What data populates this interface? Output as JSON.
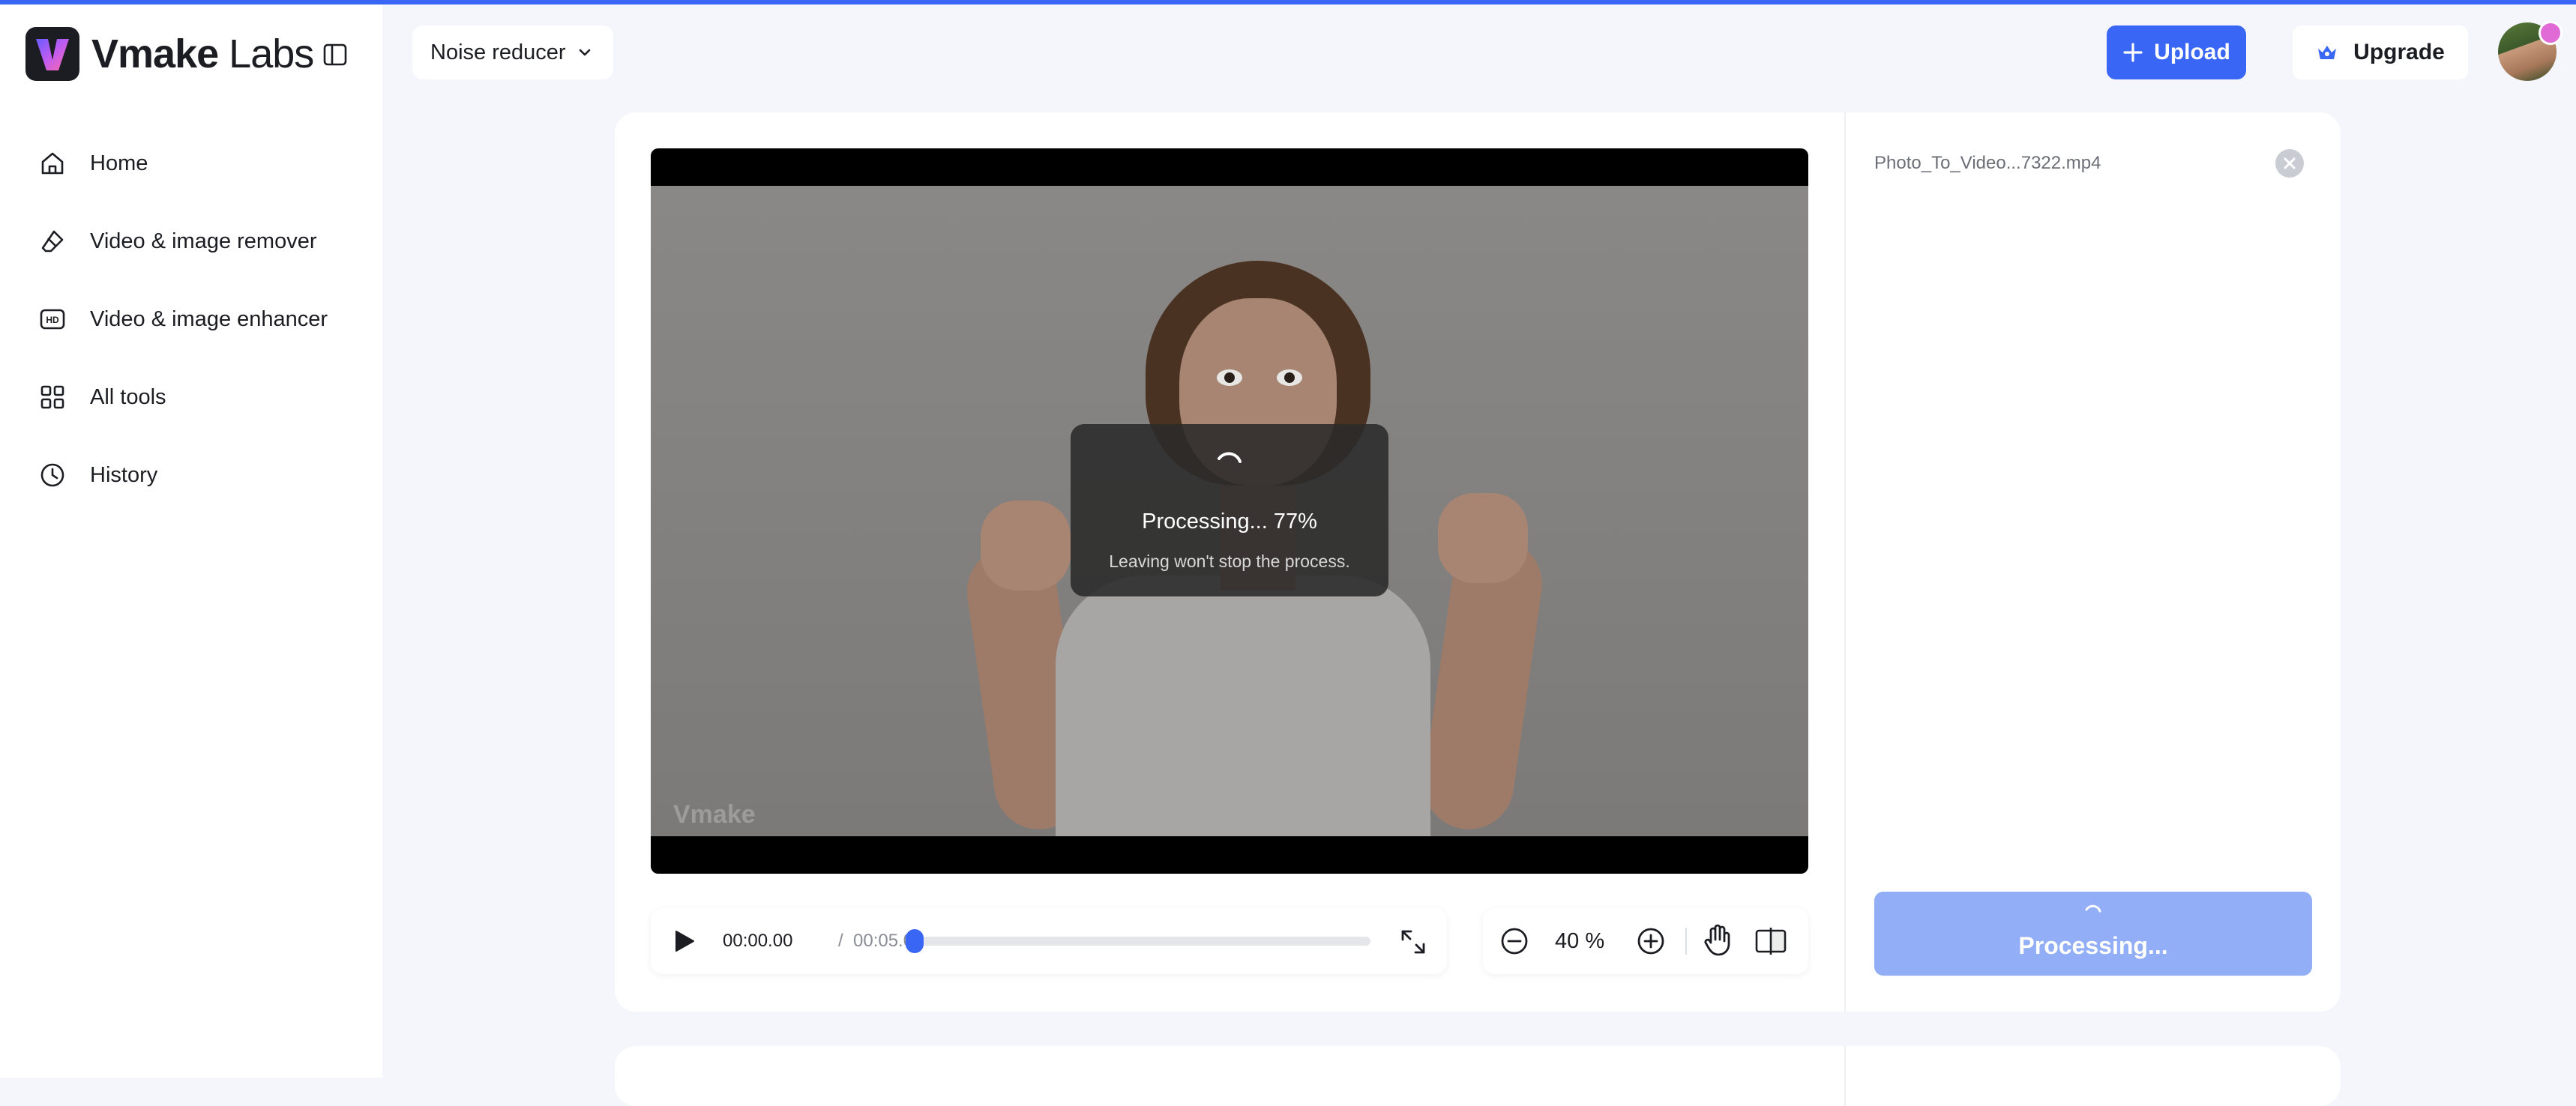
{
  "brand": {
    "name_bold": "Vmake",
    "name_light": "Labs"
  },
  "sidebar": {
    "items": [
      {
        "label": "Home",
        "icon": "home-icon"
      },
      {
        "label": "Video & image remover",
        "icon": "eraser-icon"
      },
      {
        "label": "Video & image enhancer",
        "icon": "hd-icon"
      },
      {
        "label": "All tools",
        "icon": "grid-icon"
      },
      {
        "label": "History",
        "icon": "clock-icon"
      }
    ]
  },
  "header": {
    "tool_select": "Noise reducer",
    "upload_label": "Upload",
    "upgrade_label": "Upgrade"
  },
  "video": {
    "watermark": "Vmake",
    "processing_text": "Processing... 77%",
    "processing_progress": 77,
    "processing_sub": "Leaving won't stop the process."
  },
  "player": {
    "current_time": "00:00.00",
    "separator": "/",
    "total_time": "00:05.08",
    "playback_progress": 0
  },
  "zoom": {
    "value": "40 %"
  },
  "panel": {
    "filename": "Photo_To_Video...7322.mp4",
    "process_button": "Processing..."
  },
  "colors": {
    "accent": "#3a66f5",
    "processing_button": "#92aef7"
  }
}
